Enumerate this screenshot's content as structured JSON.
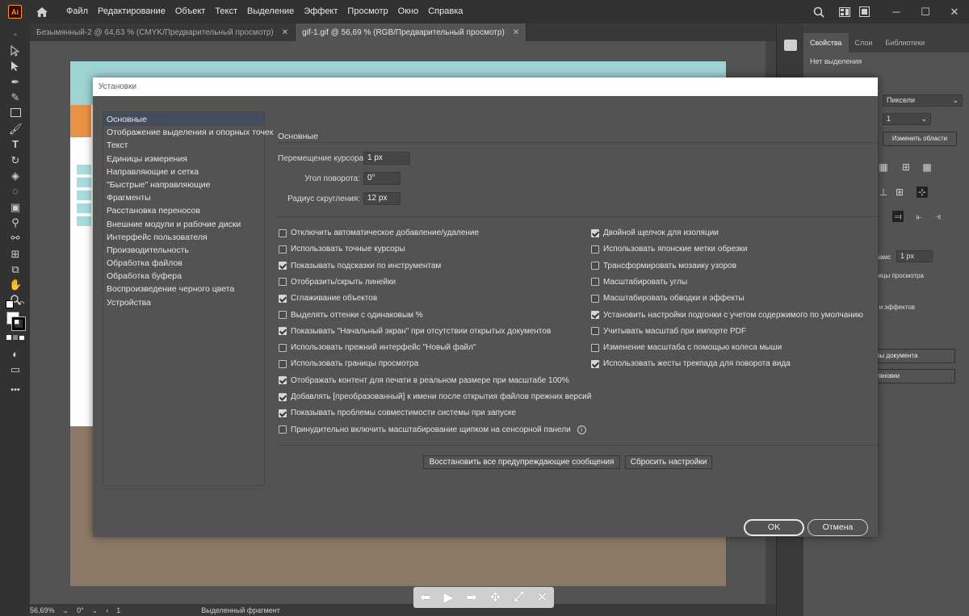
{
  "app": {
    "logo": "Ai",
    "menu": [
      "Файл",
      "Редактирование",
      "Объект",
      "Текст",
      "Выделение",
      "Эффект",
      "Просмотр",
      "Окно",
      "Справка"
    ]
  },
  "tabs": [
    {
      "label": "Безымянный-2 @ 64,63 % (CMYK/Предварительный просмотр)",
      "active": false
    },
    {
      "label": "gif-1.gif @ 56,69 % (RGB/Предварительный просмотр)",
      "active": true
    }
  ],
  "status": {
    "zoom": "56,69%",
    "rotation": "0°",
    "page": "1",
    "selection": "Выделенный фрагмент"
  },
  "right_panel": {
    "tabs": [
      "Свойства",
      "Слои",
      "Библиотеки"
    ],
    "subtitle": "Нет выделения",
    "units_value": "Пиксели",
    "artboard_value": "1",
    "edit_artboards_button": "Изменить области",
    "keyboard_increment_partial": "шамс",
    "keyboard_increment_value": "1 px",
    "view_bounds_partial": "ницы просмотра",
    "scale_effects_partial": "к и эффектов",
    "doc_setup_partial": "ры документа",
    "prefs_partial": "тановки"
  },
  "dialog": {
    "title": "Установки",
    "categories": [
      "Основные",
      "Отображение выделения и опорных точек",
      "Текст",
      "Единицы измерения",
      "Направляющие и сетка",
      "\"Быстрые\" направляющие",
      "Фрагменты",
      "Расстановка переносов",
      "Внешние модули и рабочие диски",
      "Интерфейс пользователя",
      "Производительность",
      "Обработка файлов",
      "Обработка буфера",
      "Воспроизведение черного цвета",
      "Устройства"
    ],
    "active_category": 0,
    "section_title": "Основные",
    "fields": {
      "keyboard_increment_label": "Перемещение курсора:",
      "keyboard_increment_value": "1 px",
      "constrain_angle_label": "Угол поворота:",
      "constrain_angle_value": "0°",
      "corner_radius_label": "Радиус скругления:",
      "corner_radius_value": "12 px"
    },
    "left_checks": [
      {
        "label": "Отключить автоматическое добавление/удаление",
        "checked": false
      },
      {
        "label": "Использовать точные курсоры",
        "checked": false
      },
      {
        "label": "Показывать подсказки по инструментам",
        "checked": true
      },
      {
        "label": "Отобразить/скрыть линейки",
        "checked": false
      },
      {
        "label": "Сглаживание объектов",
        "checked": true
      },
      {
        "label": "Выделять оттенки с одинаковым %",
        "checked": false
      },
      {
        "label": "Показывать \"Начальный экран\" при отсутствии открытых документов",
        "checked": true
      },
      {
        "label": "Использовать прежний интерфейс \"Новый файл\"",
        "checked": false
      },
      {
        "label": "Использовать границы просмотра",
        "checked": false
      },
      {
        "label": "Отображать контент для печати в реальном размере при масштабе 100%",
        "checked": true
      },
      {
        "label": "Добавлять [преобразованный] к имени после открытия файлов прежних версий",
        "checked": true
      },
      {
        "label": "Показывать проблемы совместимости системы при запуске",
        "checked": true
      },
      {
        "label": "Принудительно включить масштабирование щипком на сенсорной панели",
        "checked": false
      }
    ],
    "right_checks": [
      {
        "label": "Двойной щелчок для изоляции",
        "checked": true
      },
      {
        "label": "Использовать японские метки обрезки",
        "checked": false
      },
      {
        "label": "Трансформировать мозаику узоров",
        "checked": false
      },
      {
        "label": "Масштабировать углы",
        "checked": false
      },
      {
        "label": "Масштабировать обводки и эффекты",
        "checked": false
      },
      {
        "label": "Установить настройки подгонки с учетом содержимого по умолчанию",
        "checked": true
      },
      {
        "label": "Учитывать масштаб при импорте PDF",
        "checked": false
      },
      {
        "label": "Изменение масштаба с помощью колеса мыши",
        "checked": false
      },
      {
        "label": "Использовать жесты трекпада для поворота вида",
        "checked": true
      }
    ],
    "reset_warnings_button": "Восстановить все предупреждающие сообщения",
    "reset_prefs_button": "Сбросить настройки",
    "ok_button": "OK",
    "cancel_button": "Отмена"
  },
  "colors": {
    "accent_selected": "#434d5c",
    "menubar": "#323232",
    "dialog_bg": "#535353"
  }
}
